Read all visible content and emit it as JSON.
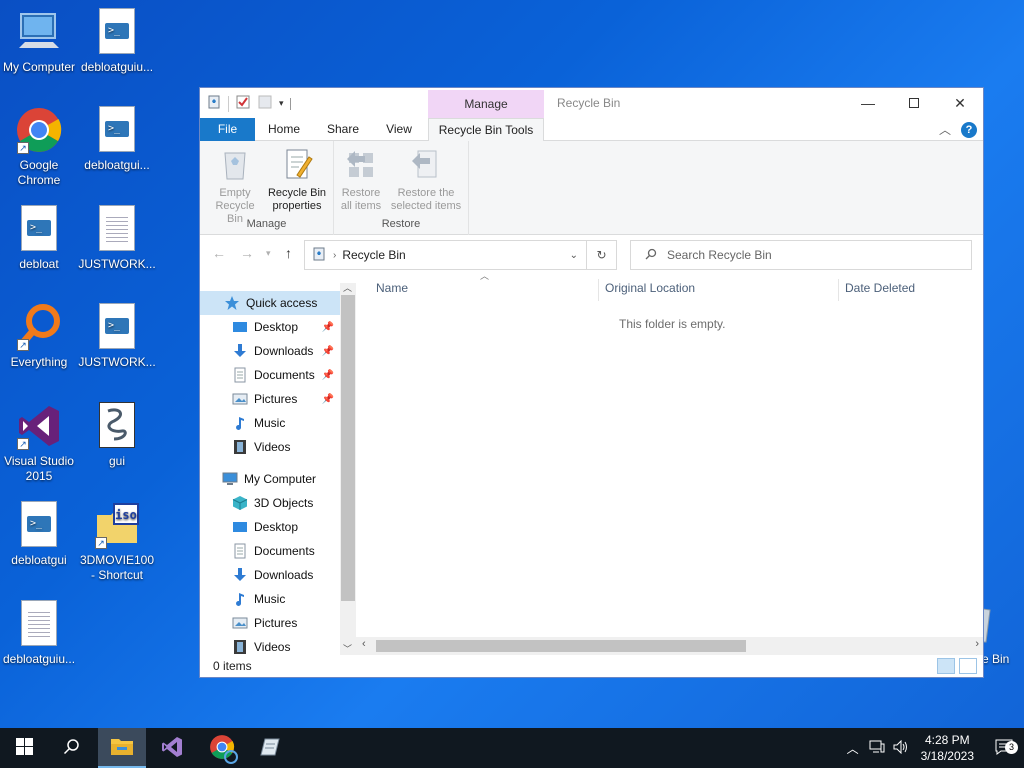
{
  "desktop": {
    "icons": [
      {
        "label": "My Computer",
        "icon": "computer-icon"
      },
      {
        "label": "debloatguiu...",
        "icon": "powershell-script-icon"
      },
      {
        "label": "Google Chrome",
        "icon": "chrome-icon"
      },
      {
        "label": "debloatgui...",
        "icon": "powershell-script-icon"
      },
      {
        "label": "debloat",
        "icon": "powershell-script-icon"
      },
      {
        "label": "JUSTWORK...",
        "icon": "text-file-icon"
      },
      {
        "label": "Everything",
        "icon": "everything-search-icon"
      },
      {
        "label": "JUSTWORK...",
        "icon": "powershell-script-icon"
      },
      {
        "label": "Visual Studio 2015",
        "icon": "visual-studio-icon"
      },
      {
        "label": "gui",
        "icon": "script-file-icon"
      },
      {
        "label": "debloatgui",
        "icon": "powershell-script-icon"
      },
      {
        "label": "3DMOVIE100 - Shortcut",
        "icon": "iso-file-icon"
      },
      {
        "label": "debloatguiu...",
        "icon": "text-file-icon"
      },
      {
        "label": "e Bin",
        "icon": "recycle-bin-icon"
      }
    ]
  },
  "window": {
    "title": "Recycle Bin",
    "context_tab_header": "Manage",
    "tabs": {
      "file": "File",
      "home": "Home",
      "share": "Share",
      "view": "View",
      "context": "Recycle Bin Tools"
    },
    "ribbon": {
      "manage_group": "Manage",
      "restore_group": "Restore",
      "empty_line1": "Empty",
      "empty_line2": "Recycle Bin",
      "props_line1": "Recycle Bin",
      "props_line2": "properties",
      "restore_all_line1": "Restore",
      "restore_all_line2": "all items",
      "restore_sel_line1": "Restore the",
      "restore_sel_line2": "selected items"
    },
    "address": {
      "crumb": "Recycle Bin"
    },
    "search": {
      "placeholder": "Search Recycle Bin"
    },
    "nav": {
      "quick_access": "Quick access",
      "qa_items": [
        "Desktop",
        "Downloads",
        "Documents",
        "Pictures",
        "Music",
        "Videos"
      ],
      "my_computer": "My Computer",
      "pc_items": [
        "3D Objects",
        "Desktop",
        "Documents",
        "Downloads",
        "Music",
        "Pictures",
        "Videos"
      ]
    },
    "columns": {
      "name": "Name",
      "original_location": "Original Location",
      "date_deleted": "Date Deleted"
    },
    "empty_message": "This folder is empty.",
    "status": "0 items"
  },
  "taskbar": {
    "time": "4:28 PM",
    "date": "3/18/2023",
    "notification_count": "3"
  },
  "colors": {
    "accent": "#1979ca",
    "context_tab": "#f1d6f6",
    "taskbar": "#101820"
  }
}
